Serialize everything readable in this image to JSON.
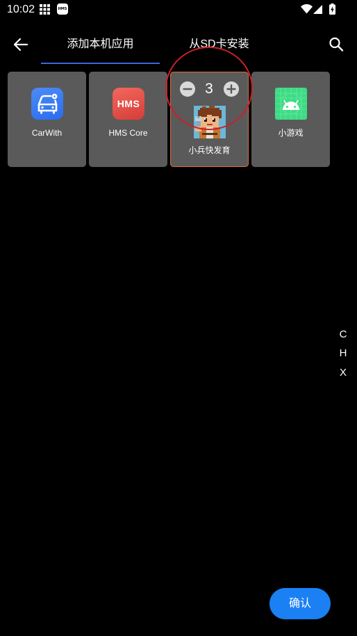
{
  "status_bar": {
    "time": "10:02",
    "notification_icons": [
      "grid-icon",
      "hms-icon"
    ],
    "hms_badge_text": "HMS",
    "system_icons": [
      "wifi-icon",
      "signal-icon",
      "battery-charging-icon"
    ]
  },
  "app_bar": {
    "back_icon": "arrow-left-icon",
    "tabs": [
      {
        "label": "添加本机应用",
        "active": true
      },
      {
        "label": "从SD卡安装",
        "active": false
      }
    ],
    "search_icon": "search-icon"
  },
  "apps": [
    {
      "name": "CarWith",
      "icon": "carwith-icon",
      "selected": false
    },
    {
      "name": "HMS Core",
      "icon": "hms-core-icon",
      "icon_text": "HMS",
      "selected": false
    },
    {
      "name": "小兵快发育",
      "icon": "pixel-boy-game-icon",
      "selected": true,
      "quantity": 3,
      "stepper": {
        "decrement_icon": "minus-circle-icon",
        "increment_icon": "plus-circle-icon"
      }
    },
    {
      "name": "小游戏",
      "icon": "android-icon",
      "selected": false
    }
  ],
  "index_bar": {
    "letters": [
      "C",
      "H",
      "X"
    ]
  },
  "confirm_button": {
    "label": "确认"
  },
  "colors": {
    "accent": "#3a68dc",
    "card": "#5a5a5a",
    "sel": "#df6d35",
    "ann": "#cc1f2a",
    "confirm": "#1b80f3",
    "stepper": "#d9d9d9"
  }
}
